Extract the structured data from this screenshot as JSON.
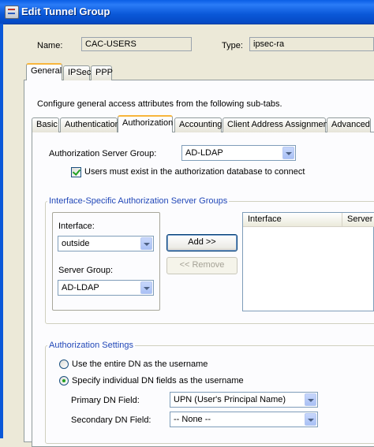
{
  "window": {
    "title": "Edit Tunnel Group"
  },
  "name_label": "Name:",
  "name_value": "CAC-USERS",
  "type_label": "Type:",
  "type_value": "ipsec-ra",
  "main_tabs": [
    "General",
    "IPSec",
    "PPP"
  ],
  "instructions": "Configure general access attributes from the following sub-tabs.",
  "sub_tabs": [
    "Basic",
    "Authentication",
    "Authorization",
    "Accounting",
    "Client Address Assignment",
    "Advanced"
  ],
  "authorization": {
    "server_group_label": "Authorization Server Group:",
    "server_group_value": "AD-LDAP",
    "users_must_exist_label": "Users must exist in the authorization database to connect",
    "users_must_exist_checked": true
  },
  "interface_groups": {
    "legend": "Interface-Specific Authorization Server Groups",
    "interface_label": "Interface:",
    "interface_value": "outside",
    "server_group_label": "Server Group:",
    "server_group_value": "AD-LDAP",
    "add_button": "Add >>",
    "remove_button": "<< Remove",
    "table_columns": [
      "Interface",
      "Server"
    ]
  },
  "authorization_settings": {
    "legend": "Authorization Settings",
    "radio_entire_dn": "Use the entire DN as the username",
    "radio_individual_dn": "Specify individual DN fields as the username",
    "selected": "individual",
    "primary_dn_label": "Primary DN Field:",
    "primary_dn_value": "UPN (User's Principal Name)",
    "secondary_dn_label": "Secondary DN Field:",
    "secondary_dn_value": "-- None --"
  },
  "colors": {
    "titlebar": "#0a58d8",
    "legend_text": "#2248b8",
    "active_tab_accent": "#f8b53c"
  }
}
